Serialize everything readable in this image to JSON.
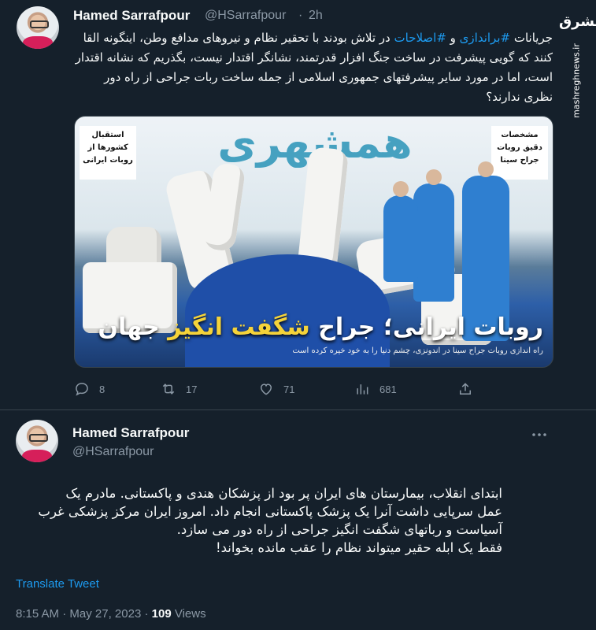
{
  "tweet1": {
    "name": "Hamed Sarrafpour",
    "handle": "@HSarrafpour",
    "separator": "·",
    "time": "2h",
    "text_before_tag1": "جریانات ",
    "tag1": "#براندازی",
    "text_between": " و ",
    "tag2": "#اصلاحات",
    "text_after": " در تلاش بودند با تحقیر نظام و نیروهای مدافع وطن، اینگونه القا کنند که گویی پیشرفت در ساخت جنگ افزار قدرتمند، نشانگر اقتدار نیست، بگذریم که نشانه اقتدار است، اما در مورد سایر پیشرفتهای جمهوری اسلامی از جمله ساخت ربات جراحی از راه دور نظری ندارند؟",
    "image": {
      "banner": "همشهری",
      "left_box": "استقبال کشورها از روبات ایرانی",
      "right_box": "مشخصات دقیق روبات جراح سینا",
      "headline_white": "روبات ایرانی؛ جراح ",
      "headline_yellow": "شگفت انگیز",
      "headline_end": " جهان",
      "subline": "راه اندازی روبات جراح سینا در اندونزی، چشم دنیا را به خود خیره کرده است"
    },
    "actions": {
      "replies": "8",
      "retweets": "17",
      "likes": "71",
      "views": "681"
    }
  },
  "watermark": {
    "logo": "مشرق",
    "url": "mashreghnews.ir"
  },
  "tweet2": {
    "name": "Hamed Sarrafpour",
    "handle": "@HSarrafpour",
    "line1": "ابتدای انقلاب، بیمارستان های ایران پر بود از پزشکان هندی و پاکستانی. مادرم یک",
    "line2": "عمل سرپایی داشت آنرا یک پزشک پاکستانی انجام داد. امروز ایران مرکز پزشکی غرب",
    "line3": "آسیاست و رباتهای شگفت انگیز جراحی از راه دور می سازد.",
    "line4": "فقط یک ابله حقیر میتواند نظام را عقب مانده بخواند!",
    "translate": "Translate Tweet",
    "time": "8:15 AM",
    "separator": "·",
    "date": "May 27, 2023",
    "views_count": "109",
    "views_label": "Views"
  },
  "colors": {
    "background": "#15202b",
    "accent": "#1d9bf0",
    "muted": "#8b98a5"
  }
}
